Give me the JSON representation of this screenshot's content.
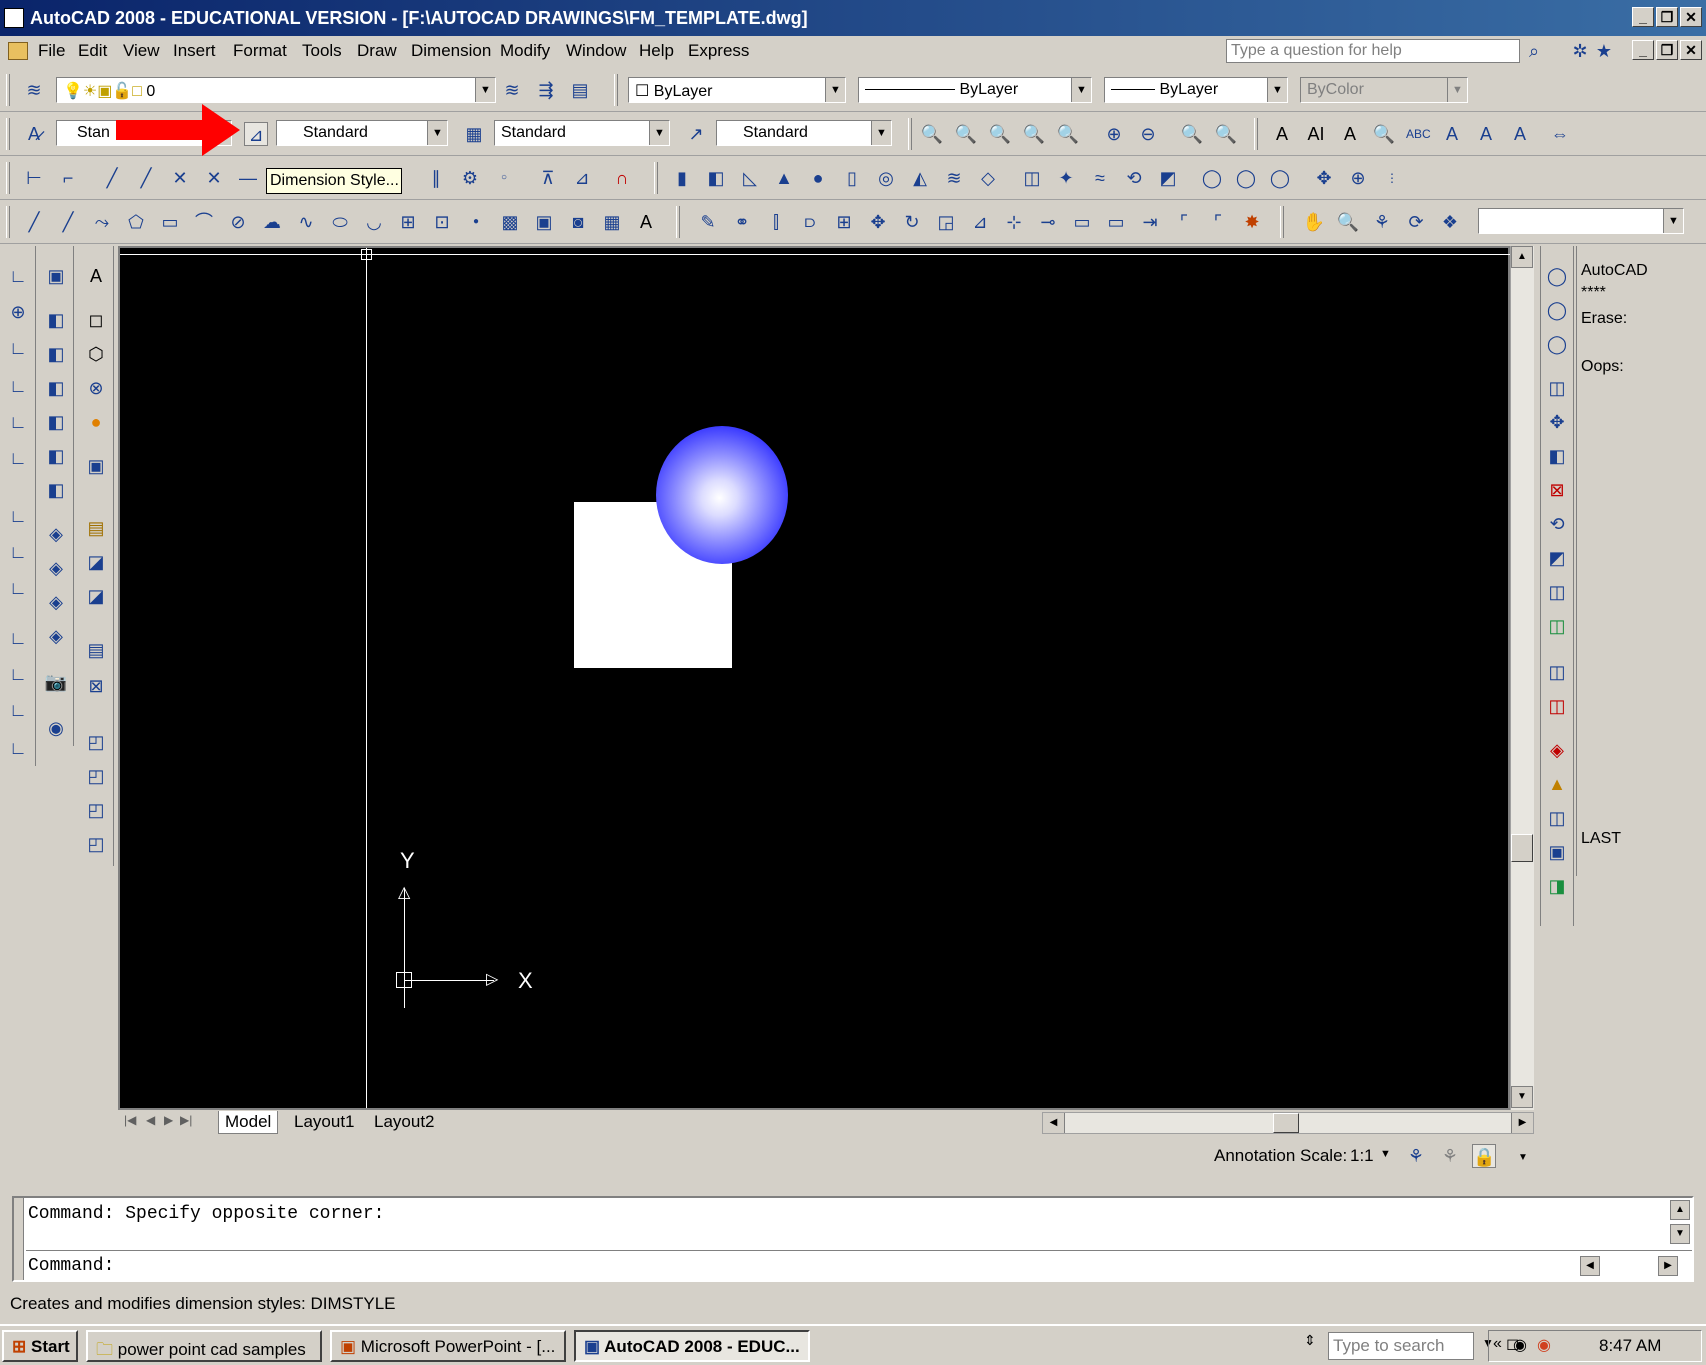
{
  "window": {
    "title": "AutoCAD 2008 - EDUCATIONAL VERSION - [F:\\AUTOCAD DRAWINGS\\FM_TEMPLATE.dwg]"
  },
  "menu": [
    "File",
    "Edit",
    "View",
    "Insert",
    "Format",
    "Tools",
    "Draw",
    "Dimension",
    "Modify",
    "Window",
    "Help",
    "Express"
  ],
  "help": {
    "placeholder": "Type a question for help"
  },
  "layers": {
    "current_layer": "0",
    "color": "ByLayer",
    "linetype": "ByLayer",
    "lineweight": "ByLayer",
    "plotstyle": "ByColor"
  },
  "styles": {
    "text_style": "Stan",
    "dim_style": "Standard",
    "table_style": "Standard",
    "mleader_style": "Standard"
  },
  "tooltip": "Dimension Style...",
  "drawing": {
    "ucs_x": "X",
    "ucs_y": "Y",
    "shapes": [
      "white rectangle",
      "blue shaded sphere"
    ]
  },
  "tabs": [
    "Model",
    "Layout1",
    "Layout2"
  ],
  "annotation": {
    "label": "Annotation Scale:",
    "value": "1:1"
  },
  "right_panel": {
    "title": "AutoCAD",
    "stars": "****",
    "lines": [
      "Erase:",
      "Oops:",
      "LAST"
    ]
  },
  "command": {
    "line1": "Command: Specify opposite corner:",
    "line2": "Command:"
  },
  "status_text": "Creates and modifies dimension styles:  DIMSTYLE",
  "taskbar": {
    "start": "Start",
    "items": [
      "power point cad samples",
      "Microsoft PowerPoint - [...",
      "AutoCAD 2008 - EDUC..."
    ],
    "search_placeholder": "Type to search",
    "clock": "8:47 AM"
  },
  "colors": {
    "accent_red": "#ff0000",
    "sphere_blue": "#1a1aff",
    "canvas_bg": "#000000"
  }
}
